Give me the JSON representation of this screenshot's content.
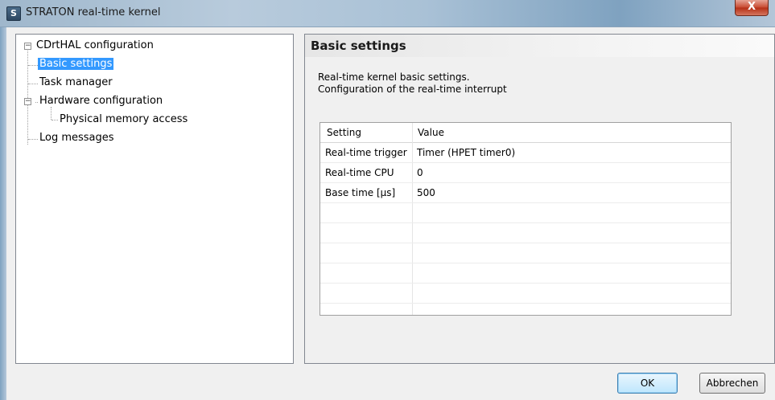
{
  "window": {
    "title": "STRATON real-time kernel",
    "icon_text": "S",
    "close_glyph": "X"
  },
  "tree": {
    "root_label": "CDrtHAL configuration",
    "items": [
      {
        "label": "Basic settings",
        "selected": true
      },
      {
        "label": "Task manager"
      },
      {
        "label": "Hardware configuration"
      },
      {
        "label": "Physical memory access"
      },
      {
        "label": "Log messages"
      }
    ],
    "collapse_glyph": "−"
  },
  "panel": {
    "title": "Basic settings",
    "description_line1": "Real-time kernel basic settings.",
    "description_line2": "Configuration of the real-time interrupt"
  },
  "grid": {
    "columns": [
      "Setting",
      "Value"
    ],
    "rows": [
      [
        "Real-time trigger",
        "Timer (HPET timer0)"
      ],
      [
        "Real-time CPU",
        "0"
      ],
      [
        "Base time [µs]",
        "500"
      ]
    ]
  },
  "buttons": {
    "ok": "OK",
    "cancel": "Abbrechen"
  },
  "colors": {
    "selection": "#3399ff",
    "title_bar": "#9fb7cc",
    "close": "#c7482f"
  }
}
